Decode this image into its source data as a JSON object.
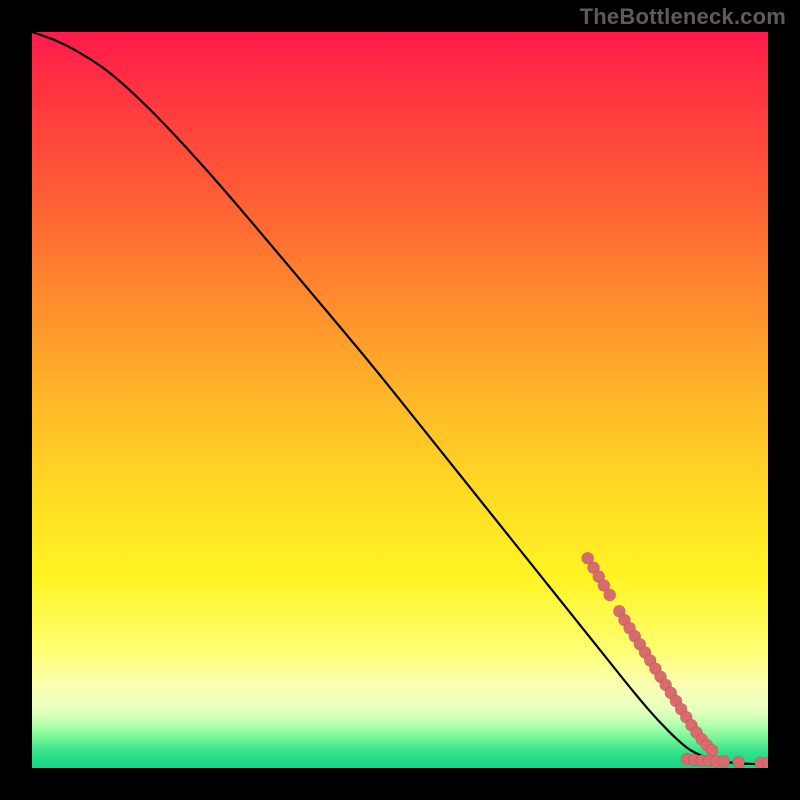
{
  "watermark": "TheBottleneck.com",
  "chart_data": {
    "type": "line",
    "title": "",
    "xlabel": "",
    "ylabel": "",
    "xlim": [
      0,
      100
    ],
    "ylim": [
      0,
      100
    ],
    "gradient_colors": {
      "top": "#ff1a4b",
      "upper_mid": "#ff842e",
      "mid": "#ffd924",
      "lower_mid": "#feff73",
      "bottom_band": "#17d484"
    },
    "series": [
      {
        "name": "bottleneck-curve",
        "color": "#000000",
        "x": [
          0,
          3,
          6,
          10,
          14,
          18,
          24,
          30,
          38,
          46,
          54,
          62,
          68,
          74,
          78,
          82,
          85,
          88,
          90,
          93,
          96,
          100
        ],
        "y": [
          100,
          99,
          97.5,
          95,
          91.5,
          87.5,
          81,
          74,
          64.5,
          55,
          45,
          35,
          27.5,
          20,
          15,
          10,
          6.5,
          3.5,
          2,
          1,
          0.6,
          0.5
        ]
      }
    ],
    "scatter": {
      "name": "highlighted-points",
      "color": "#d96a6d",
      "radius": 6,
      "points": [
        {
          "x": 75.5,
          "y": 28.5
        },
        {
          "x": 76.3,
          "y": 27.2
        },
        {
          "x": 77.0,
          "y": 26.0
        },
        {
          "x": 77.7,
          "y": 24.8
        },
        {
          "x": 78.5,
          "y": 23.5
        },
        {
          "x": 79.8,
          "y": 21.3
        },
        {
          "x": 80.5,
          "y": 20.1
        },
        {
          "x": 81.2,
          "y": 19.0
        },
        {
          "x": 81.9,
          "y": 17.9
        },
        {
          "x": 82.6,
          "y": 16.8
        },
        {
          "x": 83.3,
          "y": 15.7
        },
        {
          "x": 84.0,
          "y": 14.6
        },
        {
          "x": 84.7,
          "y": 13.5
        },
        {
          "x": 85.4,
          "y": 12.4
        },
        {
          "x": 86.1,
          "y": 11.3
        },
        {
          "x": 86.8,
          "y": 10.2
        },
        {
          "x": 87.5,
          "y": 9.1
        },
        {
          "x": 88.2,
          "y": 8.0
        },
        {
          "x": 88.9,
          "y": 6.9
        },
        {
          "x": 89.6,
          "y": 5.8
        },
        {
          "x": 90.3,
          "y": 4.8
        },
        {
          "x": 91.0,
          "y": 3.9
        },
        {
          "x": 91.7,
          "y": 3.1
        },
        {
          "x": 92.4,
          "y": 2.4
        },
        {
          "x": 89.0,
          "y": 1.2
        },
        {
          "x": 90.0,
          "y": 1.1
        },
        {
          "x": 91.0,
          "y": 1.0
        },
        {
          "x": 92.0,
          "y": 1.0
        },
        {
          "x": 93.0,
          "y": 0.9
        },
        {
          "x": 94.0,
          "y": 0.9
        },
        {
          "x": 96.0,
          "y": 0.8
        },
        {
          "x": 99.0,
          "y": 0.7
        },
        {
          "x": 100.0,
          "y": 0.7
        }
      ]
    }
  }
}
